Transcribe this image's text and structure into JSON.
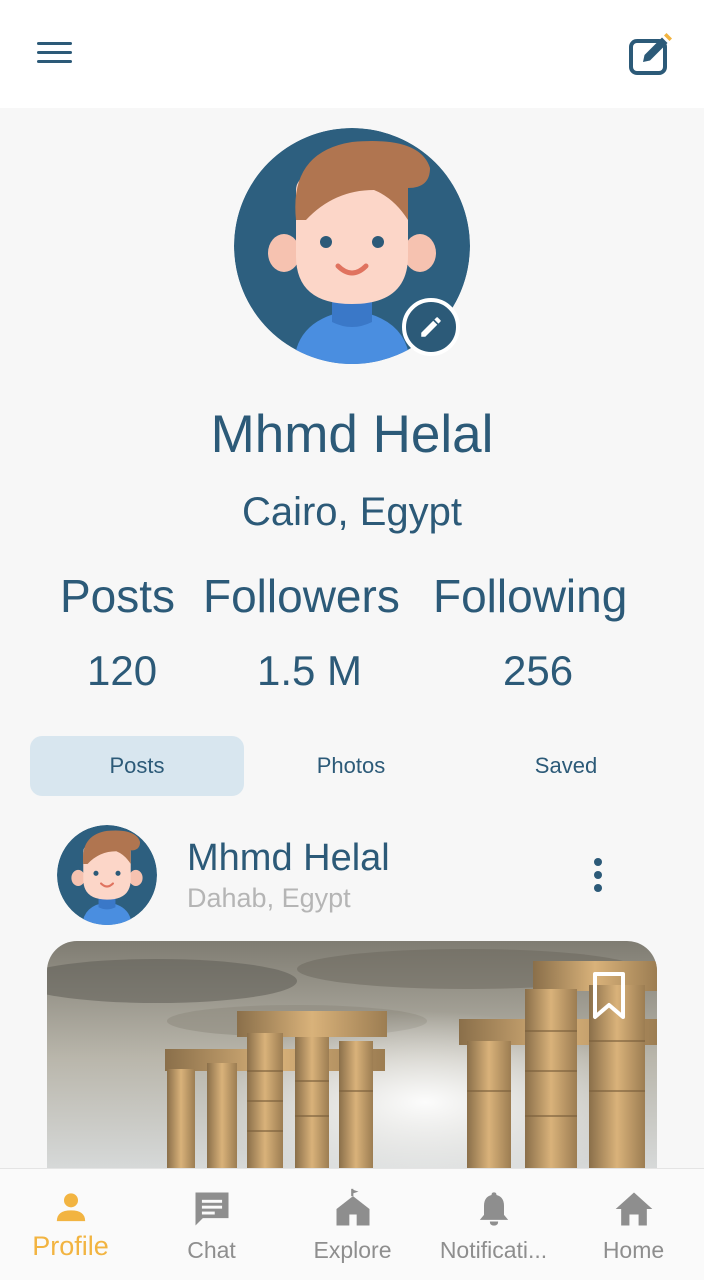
{
  "profile": {
    "name": "Mhmd Helal",
    "location": "Cairo, Egypt"
  },
  "stats": {
    "posts_label": "Posts",
    "followers_label": "Followers",
    "following_label": "Following",
    "posts_value": "120",
    "followers_value": "1.5 M",
    "following_value": "256"
  },
  "tabs": [
    {
      "label": "Posts",
      "active": true
    },
    {
      "label": "Photos",
      "active": false
    },
    {
      "label": "Saved",
      "active": false
    }
  ],
  "post": {
    "author": "Mhmd Helal",
    "location": "Dahab, Egypt"
  },
  "nav": [
    {
      "label": "Profile",
      "icon": "person-icon",
      "active": true
    },
    {
      "label": "Chat",
      "icon": "chat-icon",
      "active": false
    },
    {
      "label": "Explore",
      "icon": "explore-icon",
      "active": false
    },
    {
      "label": "Notificati...",
      "icon": "bell-icon",
      "active": false
    },
    {
      "label": "Home",
      "icon": "home-icon",
      "active": false
    }
  ],
  "colors": {
    "primary": "#2c5a78",
    "accent": "#f2b441",
    "tab_active_bg": "#d8e6ef",
    "muted": "#8e8e8e"
  }
}
